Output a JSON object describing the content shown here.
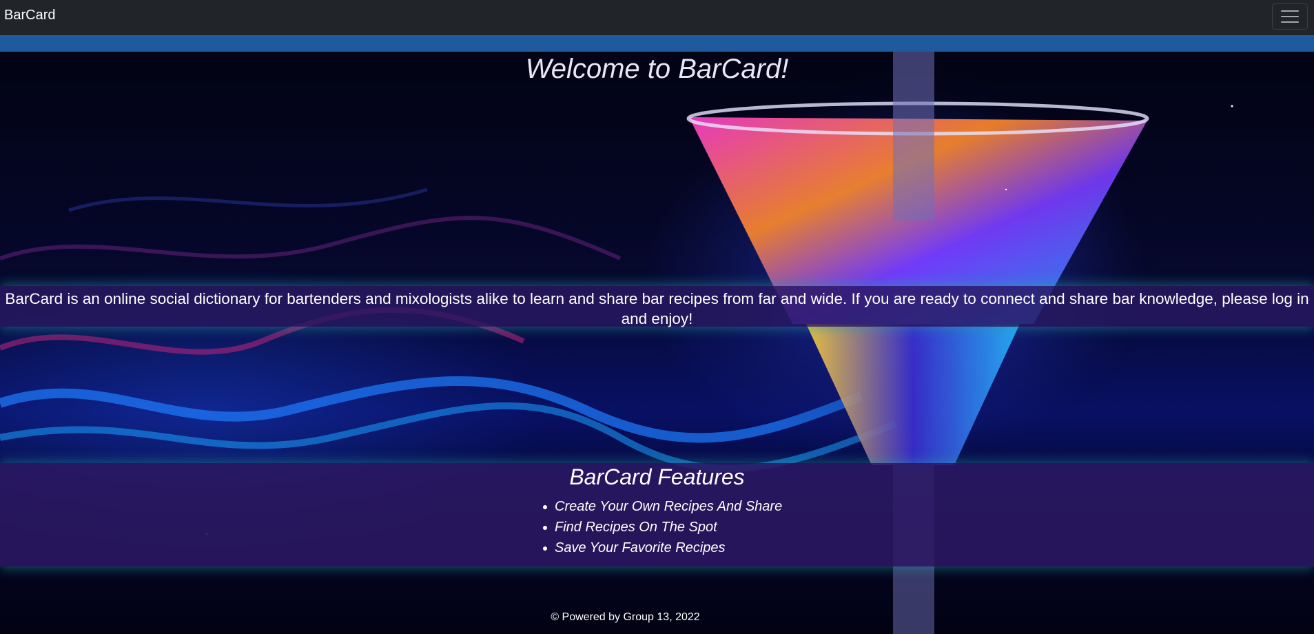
{
  "navbar": {
    "brand": "BarCard",
    "menu_icon": "hamburger-menu-icon"
  },
  "hero": {
    "title": "Welcome to BarCard!",
    "intro": "BarCard is an online social dictionary for bartenders and mixologists alike to learn and share bar recipes from far and wide. If you are ready to connect and share bar knowledge, please log in and enjoy!"
  },
  "features": {
    "title": "BarCard Features",
    "items": [
      "Create Your Own Recipes And Share",
      "Find Recipes On The Spot",
      "Save Your Favorite Recipes"
    ]
  },
  "footer": {
    "text": "© Powered by Group 13, 2022"
  },
  "colors": {
    "navbar": "#212529",
    "strip": "#1f5a9c",
    "band": "#2c1864"
  }
}
